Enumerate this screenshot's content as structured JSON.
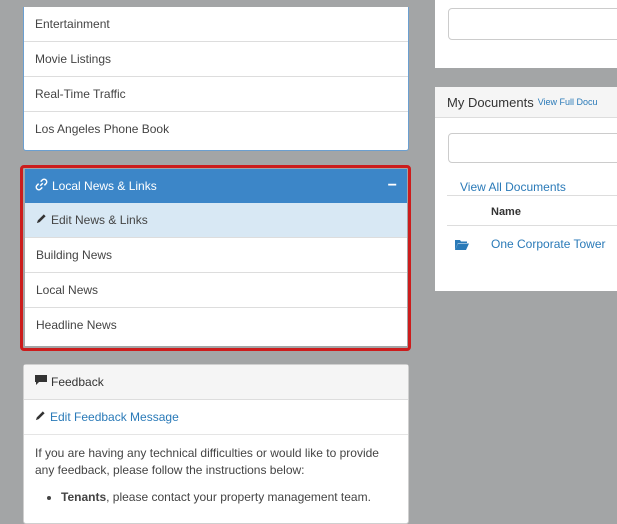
{
  "top_list": {
    "items": [
      "Entertainment",
      "Movie Listings",
      "Real-Time Traffic",
      "Los Angeles Phone Book"
    ]
  },
  "local_news": {
    "title": "Local News & Links",
    "collapse_symbol": "−",
    "edit_label": "Edit News & Links",
    "items": [
      "Building News",
      "Local News",
      "Headline News"
    ]
  },
  "feedback": {
    "title": "Feedback",
    "edit_label": "Edit Feedback Message",
    "body": "If you are having any technical difficulties or would like to provide any feedback, please follow the instructions below:",
    "bullet_strong": "Tenants",
    "bullet_text": ", please contact your property management team."
  },
  "documents": {
    "title": "My Documents",
    "header_link": "View Full Docu",
    "view_all": "View All Documents",
    "column_name": "Name",
    "rows": [
      {
        "name": "One Corporate Tower",
        "icon": "folder-open-icon"
      }
    ]
  },
  "colors": {
    "accent": "#3c86c8",
    "highlight_outline": "#cc1c1c",
    "link": "#2a7ab8"
  }
}
